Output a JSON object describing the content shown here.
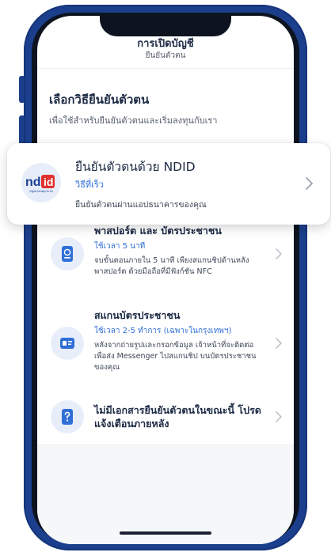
{
  "header": {
    "title": "การเปิดบัญชี",
    "subtitle": "ยืนยันตัวตน"
  },
  "intro": {
    "heading": "เลือกวิธียืนยันตัวตน",
    "text": "เพื่อใช้สำหรับยืนยันตัวตนและเริ่มลงทุนกับเรา"
  },
  "ndid": {
    "logo_text": "ndid",
    "logo_tagline": "Digital Identity for All",
    "title": "ยืนยันตัวตนด้วย NDID",
    "time": "วิธีที่เร็ว",
    "desc": "ยืนยันตัวตนผ่านแอปธนาคารของคุณ"
  },
  "options": [
    {
      "icon": "passport-icon",
      "title": "พาสปอร์ต และ บัตรประชาชน",
      "time": "ใช้เวลา 5 นาที",
      "desc": "จบขั้นตอนภายใน 5 นาที เพียงสแกนชิปด้านหลัง พาสปอร์ต ด้วยมือถือที่มีฟังก์ชัน NFC"
    },
    {
      "icon": "id-card-scan-icon",
      "title": "สแกนบัตรประชาชน",
      "time": "ใช้เวลา 2-5 ทำการ (เฉพาะในกรุงเทพฯ)",
      "desc": "หลังจากถ่ายรูปและกรอกข้อมูล เจ้าหน้าที่จะติดต่อเพื่อส่ง Messenger ไปสแกนชิป บนบัตรประชาชนของคุณ"
    },
    {
      "icon": "question-document-icon",
      "title": "ไม่มีเอกสารยืนยันตัวตนในขณะนี้ โปรดแจ้งเตือนภายหลัง"
    }
  ],
  "colors": {
    "frame": "#1b3f8c",
    "accent": "#2f6fd6",
    "ndid_red": "#e2312d",
    "ndid_navy": "#1c3f94"
  }
}
